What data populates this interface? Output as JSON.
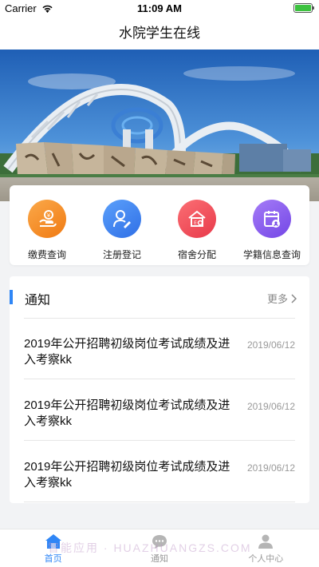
{
  "status": {
    "carrier": "Carrier",
    "time": "11:09 AM"
  },
  "nav": {
    "title": "水院学生在线"
  },
  "banner": {},
  "quick": [
    {
      "label": "缴费查询",
      "icon": "payment-icon",
      "color": "#f6901f"
    },
    {
      "label": "注册登记",
      "icon": "register-icon",
      "color": "#3d86f5"
    },
    {
      "label": "宿舍分配",
      "icon": "dormitory-icon",
      "color": "#f0505a"
    },
    {
      "label": "学籍信息查询",
      "icon": "student-record-icon",
      "color": "#8a5cf0"
    }
  ],
  "notice": {
    "title": "通知",
    "more": "更多",
    "items": [
      {
        "text": "2019年公开招聘初级岗位考试成绩及进入考察kk",
        "date": "2019/06/12"
      },
      {
        "text": "2019年公开招聘初级岗位考试成绩及进入考察kk",
        "date": "2019/06/12"
      },
      {
        "text": "2019年公开招聘初级岗位考试成绩及进入考察kk",
        "date": "2019/06/12"
      }
    ]
  },
  "tabs": [
    {
      "label": "首页",
      "icon": "home-icon",
      "active": true
    },
    {
      "label": "通知",
      "icon": "message-icon",
      "active": false
    },
    {
      "label": "个人中心",
      "icon": "user-icon",
      "active": false
    }
  ],
  "watermark": "智能应用 · HUAZHUANGZS.COM",
  "colors": {
    "accent": "#2f86f6",
    "inactive_tab": "#999999"
  }
}
